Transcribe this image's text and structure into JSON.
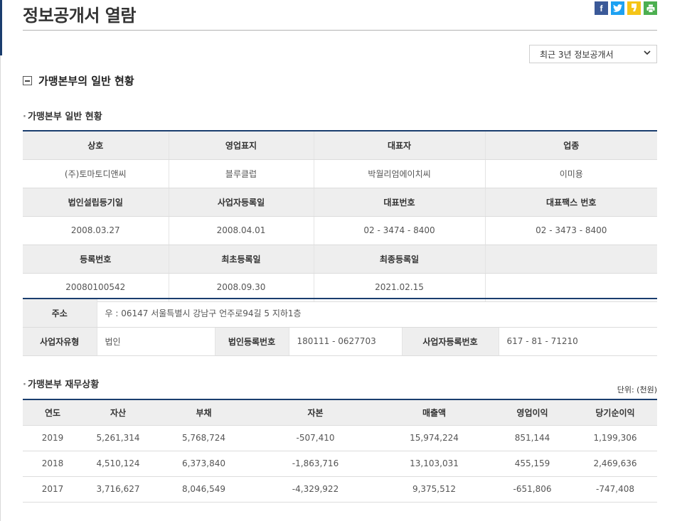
{
  "page": {
    "title": "정보공개서 열람"
  },
  "share": {
    "facebook": "f",
    "twitter": "t",
    "kakao": "s",
    "print": "p"
  },
  "select": {
    "value": "최근 3년 정보공개서"
  },
  "section": {
    "title": "가맹본부의 일반 현황"
  },
  "general": {
    "title": "가맹본부 일반 현황",
    "h1": [
      "상호",
      "영업표지",
      "대표자",
      "업종"
    ],
    "r1": [
      "(주)토마토디앤씨",
      "블루클럽",
      "박월리엄에이치씨",
      "이미용"
    ],
    "h2": [
      "법인설립등기일",
      "사업자등록일",
      "대표번호",
      "대표팩스 번호"
    ],
    "r2": [
      "2008.03.27",
      "2008.04.01",
      "02 - 3474 - 8400",
      "02 - 3473 - 8400"
    ],
    "h3": [
      "등록번호",
      "최초등록일",
      "최종등록일",
      ""
    ],
    "r3": [
      "20080100542",
      "2008.09.30",
      "2021.02.15",
      ""
    ]
  },
  "address": {
    "label": "주소",
    "value": "우 : 06147 서울특별시 강남구 언주로94길 5 지하1층",
    "biz_type_label": "사업자유형",
    "biz_type_value": "법인",
    "corp_no_label": "법인등록번호",
    "corp_no_value": "180111 - 0627703",
    "biz_no_label": "사업자등록번호",
    "biz_no_value": "617 - 81 - 71210"
  },
  "finance": {
    "title": "가맹본부 재무상황",
    "unit": "단위: (천원)",
    "headers": [
      "연도",
      "자산",
      "부채",
      "자본",
      "매출액",
      "영업이익",
      "당기순이익"
    ],
    "rows": [
      [
        "2019",
        "5,261,314",
        "5,768,724",
        "-507,410",
        "15,974,224",
        "851,144",
        "1,199,306"
      ],
      [
        "2018",
        "4,510,124",
        "6,373,840",
        "-1,863,716",
        "13,103,031",
        "455,159",
        "2,469,636"
      ],
      [
        "2017",
        "3,716,627",
        "8,046,549",
        "-4,329,922",
        "9,375,512",
        "-651,806",
        "-747,408"
      ]
    ]
  },
  "colors": {
    "accent": "#1a3d6e",
    "header_bg": "#eeeeee",
    "facebook": "#3b5998",
    "twitter": "#1da1f2",
    "kakao": "#f5c518",
    "print": "#4caf50"
  }
}
